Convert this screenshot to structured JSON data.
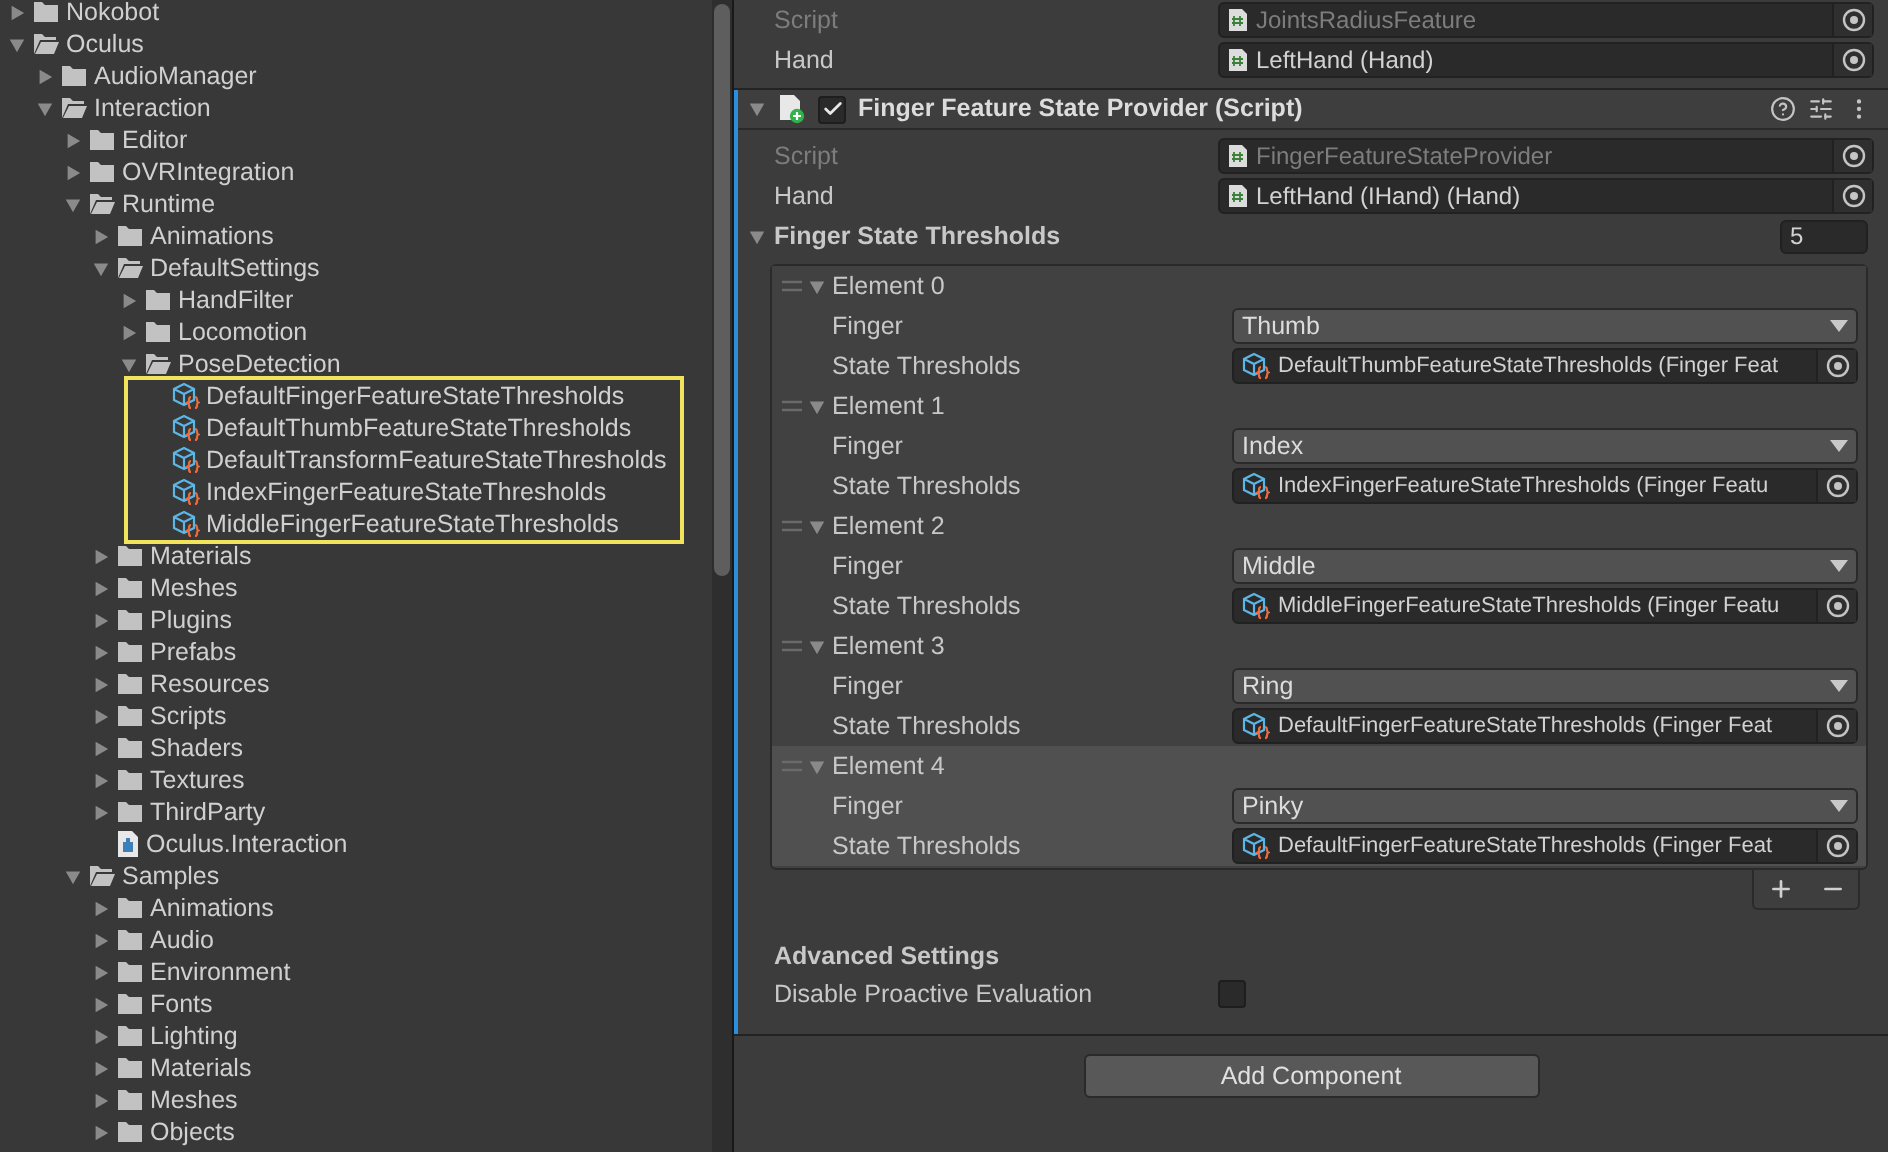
{
  "project_tree": [
    {
      "label": "Nokobot",
      "kind": "folder",
      "expanded": false
    },
    {
      "label": "Oculus",
      "kind": "folder",
      "expanded": true,
      "children": [
        {
          "label": "AudioManager",
          "kind": "folder",
          "expanded": false
        },
        {
          "label": "Interaction",
          "kind": "folder",
          "expanded": true,
          "children": [
            {
              "label": "Editor",
              "kind": "folder",
              "expanded": false
            },
            {
              "label": "OVRIntegration",
              "kind": "folder",
              "expanded": false
            },
            {
              "label": "Runtime",
              "kind": "folder",
              "expanded": true,
              "children": [
                {
                  "label": "Animations",
                  "kind": "folder",
                  "expanded": false
                },
                {
                  "label": "DefaultSettings",
                  "kind": "folder",
                  "expanded": true,
                  "children": [
                    {
                      "label": "HandFilter",
                      "kind": "folder",
                      "expanded": false
                    },
                    {
                      "label": "Locomotion",
                      "kind": "folder",
                      "expanded": false
                    },
                    {
                      "label": "PoseDetection",
                      "kind": "folder",
                      "expanded": true,
                      "highlighted": true,
                      "children": [
                        {
                          "label": "DefaultFingerFeatureStateThresholds",
                          "kind": "asset"
                        },
                        {
                          "label": "DefaultThumbFeatureStateThresholds",
                          "kind": "asset"
                        },
                        {
                          "label": "DefaultTransformFeatureStateThresholds",
                          "kind": "asset"
                        },
                        {
                          "label": "IndexFingerFeatureStateThresholds",
                          "kind": "asset"
                        },
                        {
                          "label": "MiddleFingerFeatureStateThresholds",
                          "kind": "asset"
                        }
                      ]
                    }
                  ]
                },
                {
                  "label": "Materials",
                  "kind": "folder",
                  "expanded": false
                },
                {
                  "label": "Meshes",
                  "kind": "folder",
                  "expanded": false
                },
                {
                  "label": "Plugins",
                  "kind": "folder",
                  "expanded": false
                },
                {
                  "label": "Prefabs",
                  "kind": "folder",
                  "expanded": false
                },
                {
                  "label": "Resources",
                  "kind": "folder",
                  "expanded": false
                },
                {
                  "label": "Scripts",
                  "kind": "folder",
                  "expanded": false
                },
                {
                  "label": "Shaders",
                  "kind": "folder",
                  "expanded": false
                },
                {
                  "label": "Textures",
                  "kind": "folder",
                  "expanded": false
                },
                {
                  "label": "ThirdParty",
                  "kind": "folder",
                  "expanded": false
                },
                {
                  "label": "Oculus.Interaction",
                  "kind": "assembly"
                }
              ]
            },
            {
              "label": "Samples",
              "kind": "folder",
              "expanded": true,
              "children": [
                {
                  "label": "Animations",
                  "kind": "folder",
                  "expanded": false
                },
                {
                  "label": "Audio",
                  "kind": "folder",
                  "expanded": false
                },
                {
                  "label": "Environment",
                  "kind": "folder",
                  "expanded": false
                },
                {
                  "label": "Fonts",
                  "kind": "folder",
                  "expanded": false
                },
                {
                  "label": "Lighting",
                  "kind": "folder",
                  "expanded": false
                },
                {
                  "label": "Materials",
                  "kind": "folder",
                  "expanded": false
                },
                {
                  "label": "Meshes",
                  "kind": "folder",
                  "expanded": false
                },
                {
                  "label": "Objects",
                  "kind": "folder",
                  "expanded": false
                }
              ]
            }
          ]
        }
      ]
    }
  ],
  "inspector": {
    "previous_fields": [
      {
        "label": "Script",
        "value": "JointsRadiusFeature",
        "disabled": true
      },
      {
        "label": "Hand",
        "value": "LeftHand (Hand)",
        "disabled": false
      }
    ],
    "component": {
      "title": "Finger Feature State Provider (Script)",
      "enabled": true,
      "expanded": true,
      "fields": [
        {
          "label": "Script",
          "value": "FingerFeatureStateProvider",
          "disabled": true
        },
        {
          "label": "Hand",
          "value": "LeftHand (IHand) (Hand)",
          "disabled": false
        }
      ],
      "list": {
        "label": "Finger State Thresholds",
        "expanded": true,
        "size": "5",
        "elements": [
          {
            "label": "Element 0",
            "expanded": true,
            "selected": false,
            "finger_label": "Finger",
            "finger": "Thumb",
            "thresholds_label": "State Thresholds",
            "thresholds": "DefaultThumbFeatureStateThresholds (Finger Feat"
          },
          {
            "label": "Element 1",
            "expanded": true,
            "selected": false,
            "finger_label": "Finger",
            "finger": "Index",
            "thresholds_label": "State Thresholds",
            "thresholds": "IndexFingerFeatureStateThresholds (Finger Featu"
          },
          {
            "label": "Element 2",
            "expanded": true,
            "selected": false,
            "finger_label": "Finger",
            "finger": "Middle",
            "thresholds_label": "State Thresholds",
            "thresholds": "MiddleFingerFeatureStateThresholds (Finger Featu"
          },
          {
            "label": "Element 3",
            "expanded": true,
            "selected": false,
            "finger_label": "Finger",
            "finger": "Ring",
            "thresholds_label": "State Thresholds",
            "thresholds": "DefaultFingerFeatureStateThresholds (Finger Feat"
          },
          {
            "label": "Element 4",
            "expanded": true,
            "selected": true,
            "finger_label": "Finger",
            "finger": "Pinky",
            "thresholds_label": "State Thresholds",
            "thresholds": "DefaultFingerFeatureStateThresholds (Finger Feat"
          }
        ]
      },
      "advanced_heading": "Advanced Settings",
      "advanced_fields": [
        {
          "label": "Disable Proactive Evaluation",
          "checked": false
        }
      ]
    },
    "add_button": "Add Component"
  }
}
